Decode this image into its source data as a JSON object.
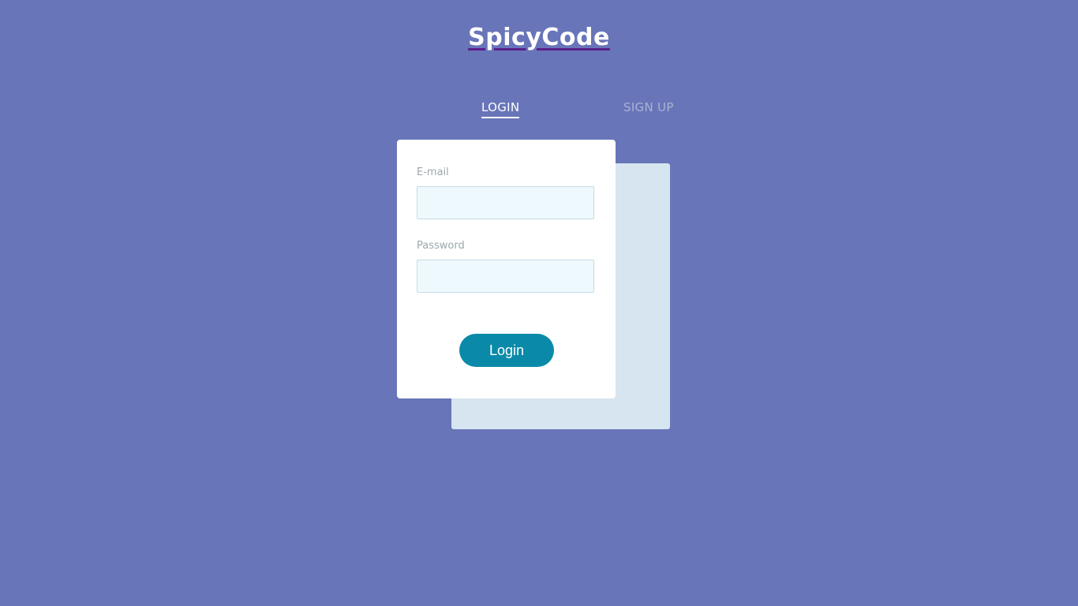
{
  "header": {
    "brand": "SpicyCode"
  },
  "tabs": {
    "login": "LOGIN",
    "signup": "SIGN UP",
    "active": "LOGIN"
  },
  "login_form": {
    "email_label": "E-mail",
    "email_value": "",
    "password_label": "Password",
    "password_value": "",
    "submit_label": "Login"
  },
  "colors": {
    "background": "#6875b8",
    "card": "#ffffff",
    "back_card": "#d6e5f0",
    "input_fill": "#eef9fd",
    "button": "#0a8aa8",
    "inactive_tab": "#a9b2d6",
    "brand_underline": "#5a1f8a"
  }
}
